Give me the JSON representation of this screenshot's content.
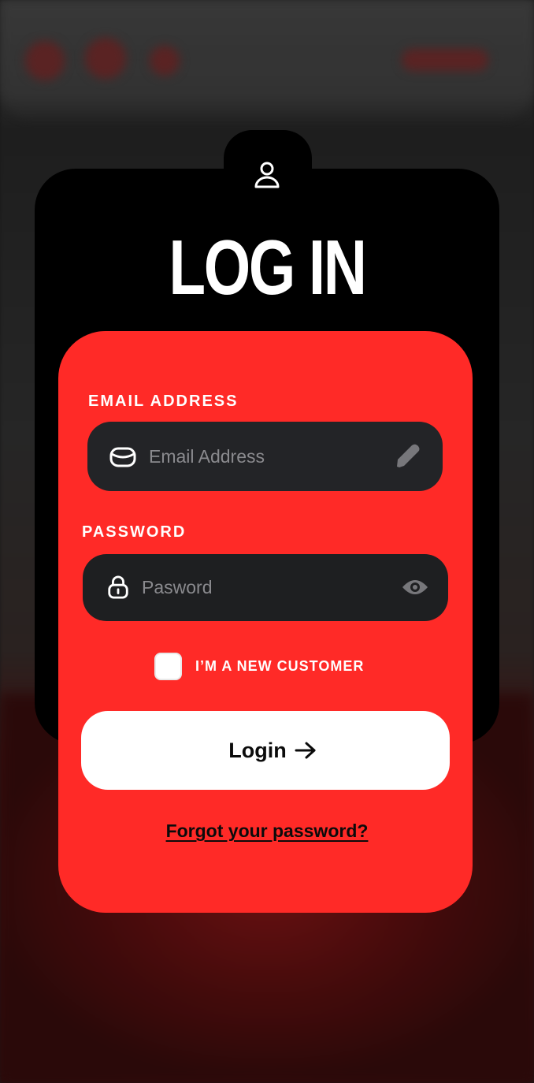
{
  "header": {
    "title": "LOG IN",
    "user_icon": "user-icon"
  },
  "form": {
    "email": {
      "label": "EMAIL ADDRESS",
      "placeholder": "Email Address",
      "lead_icon": "mail-icon",
      "trail_icon": "pencil-icon"
    },
    "password": {
      "label": "PASSWORD",
      "placeholder": "Pasword",
      "lead_icon": "lock-icon",
      "trail_icon": "eye-icon"
    },
    "new_customer": {
      "label": "I’M A NEW CUSTOMER",
      "checked": false
    },
    "login_button": {
      "label": "Login",
      "icon": "arrow-right-icon"
    },
    "forgot_link": "Forgot your password?"
  },
  "colors": {
    "accent_red": "#ff2a27",
    "card_black": "#000000",
    "input_dark": "#232427",
    "button_white": "#ffffff"
  }
}
